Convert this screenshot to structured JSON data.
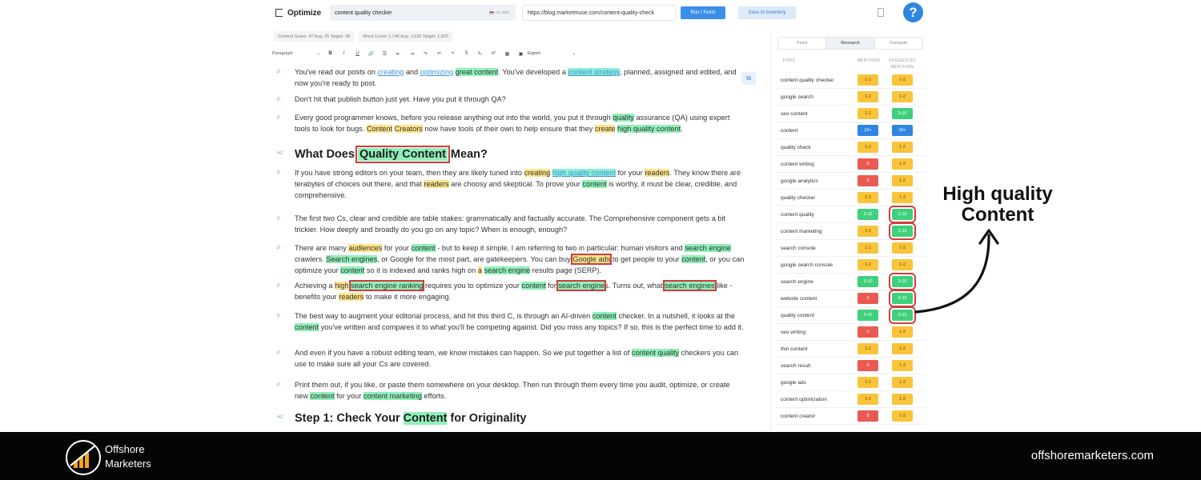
{
  "topbar": {
    "brand": "Optimize",
    "keyword": "content quality checker",
    "locale": "US SEM",
    "url": "https://blog.marketmuse.com/content-quality-check",
    "run_label": "Run / Fetch",
    "save_label": "Save to Inventory",
    "help": "?"
  },
  "stats": {
    "content_score": "Content Score: 47  Avg: 25  Target: 38",
    "word_count": "Word Count: 1,745  Avg: 1,630  Target: 1,625"
  },
  "toolbar": {
    "style": "Paragraph",
    "export": "Export",
    "buttons": [
      "B",
      "I",
      "U",
      "🔗",
      "☰",
      "⇤",
      "⇥",
      "↷",
      "↶",
      "❝",
      "S",
      "x₂",
      "x²",
      "▦",
      "▣"
    ]
  },
  "editor": {
    "tags": {
      "p": "P",
      "h2": "H2"
    },
    "blocks": [
      {
        "tag": "p",
        "segs": [
          [
            "You've read our posts on ",
            ""
          ],
          [
            "creating",
            "hb"
          ],
          [
            " and ",
            ""
          ],
          [
            "optimizing",
            "hb"
          ],
          [
            " ",
            ""
          ],
          [
            "great content",
            "hg"
          ],
          [
            ". You've developed a ",
            ""
          ],
          [
            "content strategy",
            "ht"
          ],
          [
            ", planned, assigned and edited, and now you're ready to post.",
            ""
          ]
        ]
      },
      {
        "tag": "p",
        "segs": [
          [
            "Don't hit that publish button just yet. Have you put it through QA?",
            ""
          ]
        ]
      },
      {
        "tag": "p",
        "segs": [
          [
            "Every good programmer knows, before you release anything out into the world, you put it through ",
            ""
          ],
          [
            "quality",
            "hg"
          ],
          [
            " assurance (QA) using expert tools to look for bugs. ",
            ""
          ],
          [
            "Content",
            "hy"
          ],
          [
            " ",
            ""
          ],
          [
            "Creators",
            "hy"
          ],
          [
            " now have tools of their own to help ensure that they ",
            ""
          ],
          [
            "create",
            "hy"
          ],
          [
            " ",
            ""
          ],
          [
            "high quality content",
            "hg"
          ],
          [
            ".",
            ""
          ]
        ]
      },
      {
        "tag": "h2",
        "segs": [
          [
            "What Does ",
            ""
          ],
          [
            "Quality Content",
            "hg box"
          ],
          [
            " Mean?",
            ""
          ]
        ]
      },
      {
        "tag": "p",
        "segs": [
          [
            "If you have strong editors on your team, then they are likely tuned into ",
            ""
          ],
          [
            "creating",
            "hy"
          ],
          [
            " ",
            ""
          ],
          [
            "high quality content",
            "ht"
          ],
          [
            " for your ",
            ""
          ],
          [
            "readers",
            "hy"
          ],
          [
            ". They know there are terabytes of choices out there, and that ",
            ""
          ],
          [
            "readers",
            "hy"
          ],
          [
            " are choosy and skeptical. To prove your ",
            ""
          ],
          [
            "content",
            "hg"
          ],
          [
            " is worthy, it must be clear, credible, and comprehensive.",
            ""
          ]
        ]
      },
      {
        "tag": "p",
        "segs": [
          [
            "The first two Cs, clear and credible are table stakes: grammatically and factually accurate. The Comprehensive component gets a bit trickier. How deeply and broadly do you go on any topic? When is enough, enough?",
            ""
          ]
        ]
      },
      {
        "tag": "p",
        "segs": [
          [
            "There are many ",
            ""
          ],
          [
            "audiences",
            "hy"
          ],
          [
            " for your ",
            ""
          ],
          [
            "content",
            "hg"
          ],
          [
            " - but to keep it simple, I am referring to two in particular: human visitors and ",
            ""
          ],
          [
            "search engine",
            "hg"
          ],
          [
            " crawlers. ",
            ""
          ],
          [
            "Search engines",
            "hg"
          ],
          [
            ", or Google for the most part, are gatekeepers. You can buy ",
            ""
          ],
          [
            "Google ads",
            "hy box"
          ],
          [
            " to get people to your ",
            ""
          ],
          [
            "content",
            "hg"
          ],
          [
            ", or you can optimize your ",
            ""
          ],
          [
            "content",
            "hg"
          ],
          [
            " so it is indexed and ranks high on ",
            ""
          ],
          [
            "a",
            "hy"
          ],
          [
            " ",
            ""
          ],
          [
            "search engine",
            "hg"
          ],
          [
            " results page (SERP).",
            ""
          ]
        ]
      },
      {
        "tag": "p",
        "segs": [
          [
            "Achieving a ",
            ""
          ],
          [
            "high",
            "hy"
          ],
          [
            " ",
            ""
          ],
          [
            "search engine ranking",
            "hg box"
          ],
          [
            " requires you to optimize your ",
            ""
          ],
          [
            "content",
            "hg"
          ],
          [
            " for ",
            ""
          ],
          [
            "search engine",
            "hg box"
          ],
          [
            "s. Turns out, what ",
            ""
          ],
          [
            "search engines",
            "hg box"
          ],
          [
            " like - benefits your ",
            ""
          ],
          [
            "readers",
            "hy"
          ],
          [
            " to make it more engaging.",
            ""
          ]
        ]
      },
      {
        "tag": "p",
        "segs": [
          [
            "The best way to augment your editorial process, and hit this third C, is through an AI-driven ",
            ""
          ],
          [
            "content",
            "hg"
          ],
          [
            " checker. In a nutshell, it looks at the ",
            ""
          ],
          [
            "content",
            "hg"
          ],
          [
            " you've written and compares it to what you'll be competing against. Did you miss any topics? If so, this is the perfect time to add it.",
            ""
          ]
        ]
      },
      {
        "tag": "p",
        "segs": [
          [
            "And even if you have a robust editing team, we know mistakes can happen. So we put together a list of ",
            ""
          ],
          [
            "content quality",
            "hg"
          ],
          [
            " checkers you can use to make sure all your Cs are covered.",
            ""
          ]
        ]
      },
      {
        "tag": "p",
        "segs": [
          [
            "Print them out, if you like, or paste them somewhere on your desktop. Then run through them every time you audit, optimize, or create new ",
            ""
          ],
          [
            "content",
            "hg"
          ],
          [
            " for your ",
            ""
          ],
          [
            "content marketing",
            "hg"
          ],
          [
            " efforts.",
            ""
          ]
        ]
      },
      {
        "tag": "h2",
        "segs": [
          [
            "Step 1: Check Your ",
            ""
          ],
          [
            "Content",
            "hg"
          ],
          [
            " for Originality",
            ""
          ]
        ]
      }
    ]
  },
  "panel": {
    "tabs": [
      "Feed",
      "Research",
      "Compete"
    ],
    "active_tab": "Research",
    "headers": {
      "topic": "TOPIC",
      "mentions": "MENTIONS",
      "suggested": "SUGGESTED MENTIONS"
    },
    "rows": [
      {
        "topic": "content quality checker",
        "m": "1-2",
        "mc": "yellow",
        "s": "1-2",
        "sc": "yellow"
      },
      {
        "topic": "google search",
        "m": "1-2",
        "mc": "yellow",
        "s": "1-2",
        "sc": "yellow"
      },
      {
        "topic": "seo content",
        "m": "1-2",
        "mc": "yellow",
        "s": "3-10",
        "sc": "green"
      },
      {
        "topic": "content",
        "m": "10+",
        "mc": "blue",
        "s": "10+",
        "sc": "blue"
      },
      {
        "topic": "quality check",
        "m": "1-2",
        "mc": "yellow",
        "s": "1-2",
        "sc": "yellow"
      },
      {
        "topic": "content writing",
        "m": "0",
        "mc": "red",
        "s": "1-2",
        "sc": "yellow"
      },
      {
        "topic": "google analytics",
        "m": "0",
        "mc": "red",
        "s": "1-2",
        "sc": "yellow"
      },
      {
        "topic": "quality checker",
        "m": "1-2",
        "mc": "yellow",
        "s": "1-2",
        "sc": "yellow"
      },
      {
        "topic": "content quality",
        "m": "3-10",
        "mc": "green",
        "s": "3-10",
        "sc": "green",
        "boxed": true
      },
      {
        "topic": "content marketing",
        "m": "1-2",
        "mc": "yellow",
        "s": "3-10",
        "sc": "green",
        "boxed": true
      },
      {
        "topic": "search console",
        "m": "1-2",
        "mc": "yellow",
        "s": "1-2",
        "sc": "yellow"
      },
      {
        "topic": "google search console",
        "m": "1-2",
        "mc": "yellow",
        "s": "1-2",
        "sc": "yellow"
      },
      {
        "topic": "search engine",
        "m": "3-10",
        "mc": "green",
        "s": "3-10",
        "sc": "green",
        "boxed": true
      },
      {
        "topic": "website content",
        "m": "0",
        "mc": "red",
        "s": "3-10",
        "sc": "green",
        "boxed": true
      },
      {
        "topic": "quality content",
        "m": "3-10",
        "mc": "green",
        "s": "3-10",
        "sc": "green",
        "boxed": true
      },
      {
        "topic": "seo writing",
        "m": "0",
        "mc": "red",
        "s": "1-2",
        "sc": "yellow"
      },
      {
        "topic": "thin content",
        "m": "1-2",
        "mc": "yellow",
        "s": "1-2",
        "sc": "yellow"
      },
      {
        "topic": "search result",
        "m": "0",
        "mc": "red",
        "s": "1-2",
        "sc": "yellow"
      },
      {
        "topic": "google ads",
        "m": "1-2",
        "mc": "yellow",
        "s": "1-2",
        "sc": "yellow"
      },
      {
        "topic": "content optimization",
        "m": "1-2",
        "mc": "yellow",
        "s": "1-2",
        "sc": "yellow"
      },
      {
        "topic": "content creator",
        "m": "0",
        "mc": "red",
        "s": "1-2",
        "sc": "yellow"
      }
    ]
  },
  "annotation": {
    "line1": "High quality",
    "line2": "Content"
  },
  "footer": {
    "brand_line1": "Offshore",
    "brand_line2": "Marketers",
    "domain": "offshoremarketers.com"
  },
  "colors": {
    "accent": "#2f86e0",
    "highlight_yellow": "#fde38a",
    "highlight_green": "#8ff0b9",
    "annotation_red": "#d23c3c",
    "footer_bg": "#050505"
  }
}
